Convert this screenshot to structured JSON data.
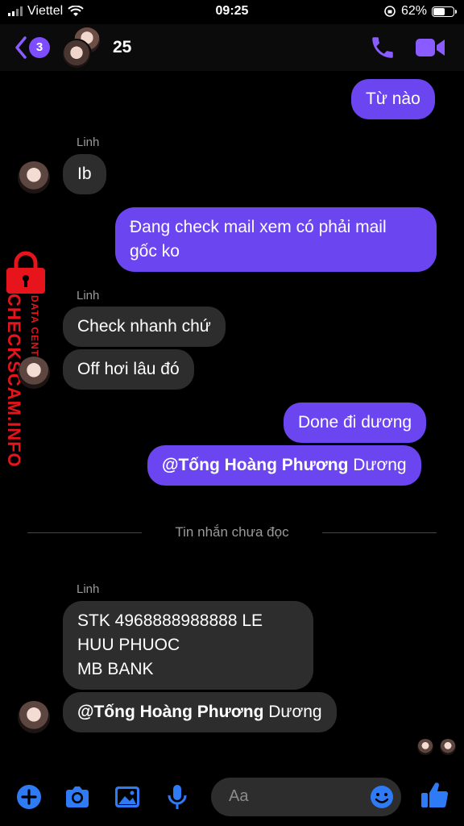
{
  "status": {
    "carrier": "Viettel",
    "time": "09:25",
    "battery": "62%",
    "battery_level": 0.62
  },
  "header": {
    "back_badge": "3",
    "title": "25"
  },
  "messages": {
    "m1": "Từ nào",
    "sender1": "Linh",
    "m2": "Ib",
    "m3_l1": "Đang check mail xem có phải mail",
    "m3_l2": "gốc ko",
    "sender2": "Linh",
    "m4": "Check nhanh chứ",
    "m5": "Off hơi lâu đó",
    "m6": "Done đi dương",
    "m7_mention": "@Tống Hoàng Phương",
    "m7_rest": " Dương",
    "unread_label": "Tin nhắn chưa đọc",
    "sender3": "Linh",
    "m8_l1": "STK 4968888988888 LE",
    "m8_l2": "HUU PHUOC",
    "m8_l3": "MB BANK",
    "m9_mention": "@Tống Hoàng Phương",
    "m9_rest": " Dương"
  },
  "watermark": {
    "brand": "CHECKSCAM.INFO",
    "sub": "DATA CENTER",
    "color": "#e8141c"
  },
  "composer": {
    "placeholder": "Aa"
  },
  "colors": {
    "accent": "#7d4dff",
    "outgoing": "#6b46f0",
    "incoming": "#2d2d2d"
  },
  "icons": [
    "signal-icon",
    "wifi-icon",
    "battery-icon",
    "back-chevron-icon",
    "phone-icon",
    "video-camera-icon",
    "plus-icon",
    "camera-icon",
    "image-icon",
    "microphone-icon",
    "emoji-icon",
    "like-icon",
    "lock-icon"
  ]
}
